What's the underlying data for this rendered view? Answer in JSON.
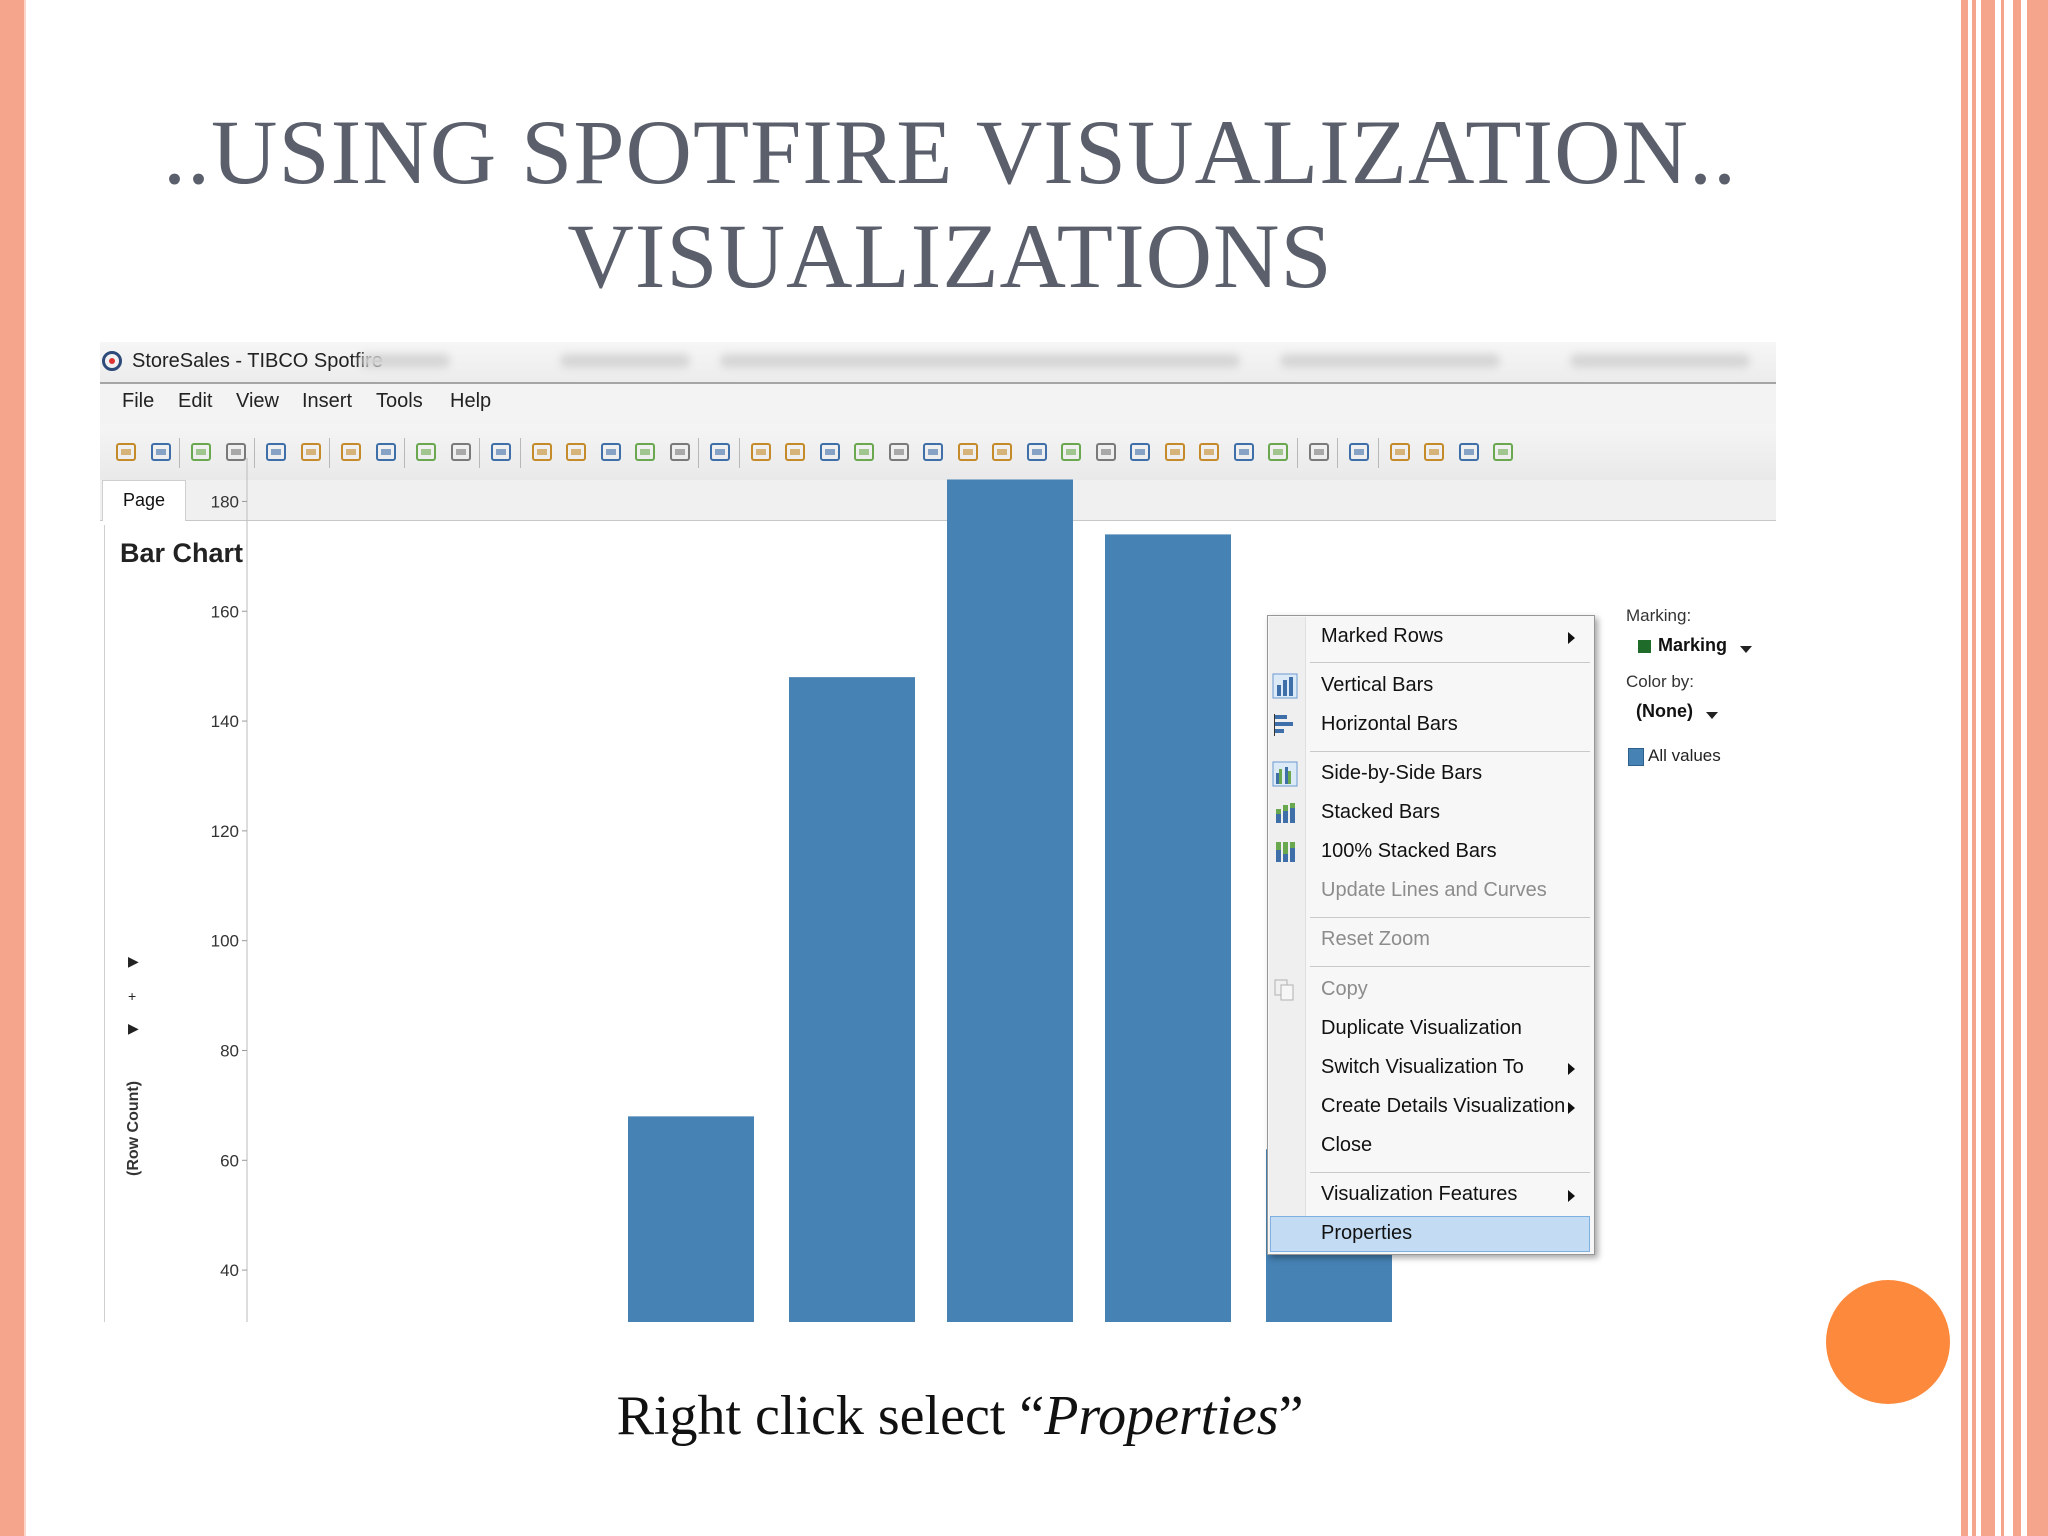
{
  "slide": {
    "title_line1": "..USING SPOTFIRE VISUALIZATION..",
    "title_line2": "VISUALIZATIONS",
    "caption_pre": "Right click select “",
    "caption_em": "Properties",
    "caption_post": "”"
  },
  "app": {
    "window_title": "StoreSales - TIBCO Spotfire",
    "menu": [
      "File",
      "Edit",
      "View",
      "Insert",
      "Tools",
      "Help"
    ],
    "page_tab": "Page",
    "visualization_title": "Bar Chart",
    "toolbar_icons": [
      "open-icon",
      "add-data-icon",
      "reload-icon",
      "save-icon",
      "print-icon",
      "export-icon",
      "copy-icon",
      "paste-icon",
      "undo-icon",
      "redo-icon",
      "reset-icon",
      "filter-icon",
      "details-icon",
      "tags-icon",
      "bookmark-icon",
      "lists-icon",
      "new-page-icon",
      "table-icon",
      "cross-table-icon",
      "graphical-table-icon",
      "bar-chart-icon",
      "line-chart-icon",
      "combination-chart-icon",
      "pie-chart-icon",
      "scatter-plot-icon",
      "3d-scatter-icon",
      "map-icon",
      "treemap-icon",
      "heat-map-icon",
      "parallel-coordinates-icon",
      "summary-table-icon",
      "box-plot-icon",
      "network-icon",
      "text-area-icon",
      "data-relationships-icon",
      "layout-2-icon",
      "layout-columns-icon",
      "layout-rows-icon",
      "maximize-icon"
    ]
  },
  "legend": {
    "marking_label": "Marking:",
    "marking_value": "Marking",
    "color_by_label": "Color by:",
    "color_by_value": "(None)",
    "all_values": "All values",
    "marking_color": "#1f6b2a",
    "series_color": "#4682b4"
  },
  "chart_data": {
    "type": "bar",
    "ylabel": "(Row Count)",
    "ylim": [
      40,
      190
    ],
    "yticks": [
      40,
      60,
      80,
      100,
      120,
      140,
      160,
      180
    ],
    "values": [
      68,
      148,
      184,
      174,
      62
    ],
    "bar_color": "#4682b4"
  },
  "context_menu": {
    "items": [
      {
        "label": "Marked Rows",
        "submenu": true,
        "disabled": false,
        "icon": ""
      },
      {
        "label": "Vertical Bars",
        "submenu": false,
        "disabled": false,
        "icon": "vertical-bars-icon"
      },
      {
        "label": "Horizontal Bars",
        "submenu": false,
        "disabled": false,
        "icon": "horizontal-bars-icon"
      },
      {
        "label": "Side-by-Side Bars",
        "submenu": false,
        "disabled": false,
        "icon": "side-by-side-bars-icon"
      },
      {
        "label": "Stacked Bars",
        "submenu": false,
        "disabled": false,
        "icon": "stacked-bars-icon"
      },
      {
        "label": "100% Stacked Bars",
        "submenu": false,
        "disabled": false,
        "icon": "100-stacked-bars-icon"
      },
      {
        "label": "Update Lines and Curves",
        "submenu": false,
        "disabled": true,
        "icon": ""
      },
      {
        "label": "Reset Zoom",
        "submenu": false,
        "disabled": true,
        "icon": ""
      },
      {
        "label": "Copy",
        "submenu": false,
        "disabled": true,
        "icon": "copy-icon"
      },
      {
        "label": "Duplicate Visualization",
        "submenu": false,
        "disabled": false,
        "icon": ""
      },
      {
        "label": "Switch Visualization To",
        "submenu": true,
        "disabled": false,
        "icon": ""
      },
      {
        "label": "Create Details Visualization",
        "submenu": true,
        "disabled": false,
        "icon": ""
      },
      {
        "label": "Close",
        "submenu": false,
        "disabled": false,
        "icon": ""
      },
      {
        "label": "Visualization Features",
        "submenu": true,
        "disabled": false,
        "icon": ""
      },
      {
        "label": "Properties",
        "submenu": false,
        "disabled": false,
        "icon": "",
        "highlighted": true
      }
    ]
  }
}
